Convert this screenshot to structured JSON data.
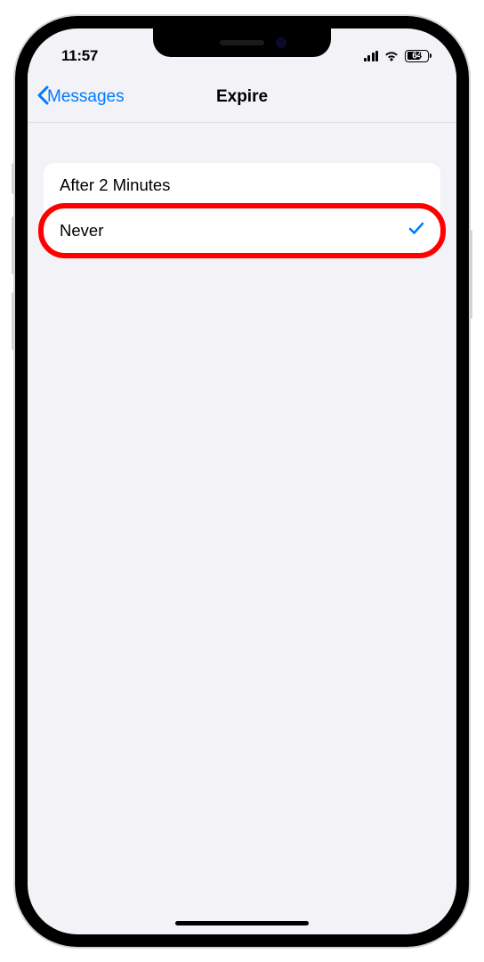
{
  "status_bar": {
    "time": "11:57",
    "battery_percent": "64"
  },
  "nav": {
    "back_label": "Messages",
    "title": "Expire"
  },
  "options": [
    {
      "label": "After 2 Minutes",
      "selected": false,
      "highlighted": false
    },
    {
      "label": "Never",
      "selected": true,
      "highlighted": true
    }
  ]
}
